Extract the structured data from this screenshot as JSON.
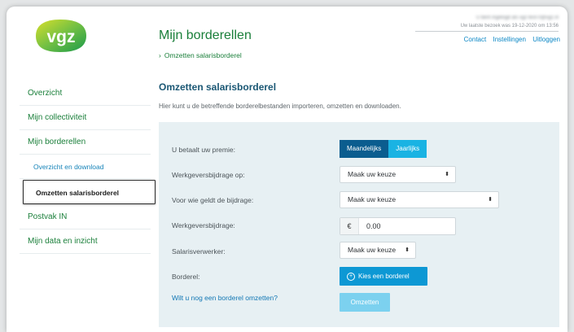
{
  "header": {
    "logo_text": "vgz",
    "page_title": "Mijn borderellen",
    "breadcrumb": "Omzetten salarisborderel",
    "user_line": "U bent ingelogd als vgz-test-0@vgz.nl",
    "last_visit": "Uw laatste bezoek was 19-12-2020 om 13:56",
    "links": [
      "Contact",
      "Instellingen",
      "Uitloggen"
    ]
  },
  "sidebar": {
    "items": [
      {
        "label": "Overzicht"
      },
      {
        "label": "Mijn collectiviteit"
      },
      {
        "label": "Mijn borderellen"
      },
      {
        "label": "Overzicht en download"
      },
      {
        "label": "Omzetten salarisborderel"
      },
      {
        "label": "Postvak IN"
      },
      {
        "label": "Mijn data en inzicht"
      }
    ]
  },
  "main": {
    "title": "Omzetten salarisborderel",
    "description": "Hier kunt u de betreffende borderelbestanden importeren, omzetten en downloaden.",
    "premium_label": "U betaalt uw premie:",
    "premium_options": [
      "Maandelijks",
      "Jaarlijks"
    ],
    "contribution_on_label": "Werkgeversbijdrage op:",
    "contribution_on_value": "Maak uw keuze",
    "for_whom_label": "Voor wie geldt de bijdrage:",
    "for_whom_value": "Maak uw keuze",
    "contribution_label": "Werkgeversbijdrage:",
    "currency": "€",
    "contribution_value": "0.00",
    "payroll_label": "Salarisverwerker:",
    "payroll_value": "Maak uw keuze",
    "borderel_label": "Borderel:",
    "choose_button": "Kies een borderel",
    "again_link": "Wilt u nog een borderel omzetten?",
    "convert_button": "Omzetten"
  },
  "colors": {
    "brand_green": "#1a7f3a",
    "accent_blue": "#0d98d4",
    "dark_blue": "#0b5d8f",
    "panel_bg": "#e7f0f3"
  }
}
